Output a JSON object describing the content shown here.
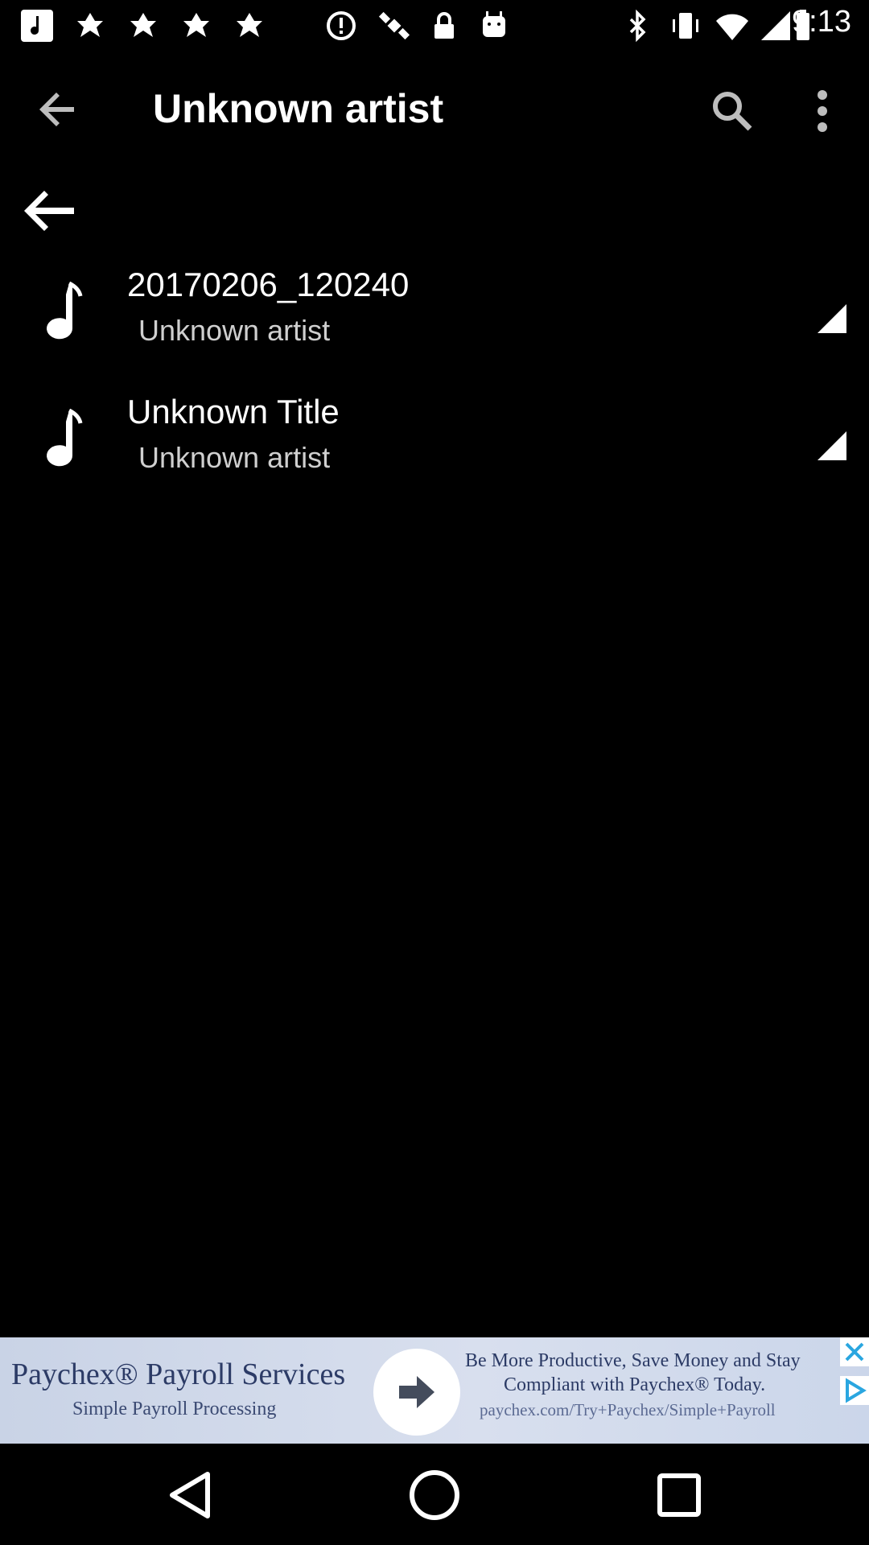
{
  "status_bar": {
    "time": "9:13",
    "icons": [
      "music-note-icon",
      "flower-icon",
      "flower-icon",
      "flower-icon",
      "alert-icon",
      "satellite-icon",
      "lock-icon",
      "android-icon",
      "bluetooth-icon",
      "vibrate-icon",
      "wifi-icon",
      "signal-icon",
      "battery-icon"
    ]
  },
  "app_bar": {
    "title": "Unknown artist",
    "back_icon": "back-arrow-icon",
    "search_icon": "search-icon",
    "more_icon": "more-vert-icon"
  },
  "tracks": [
    {
      "title": "20170206_120240",
      "artist": "Unknown artist"
    },
    {
      "title": "Unknown Title",
      "artist": "Unknown artist"
    }
  ],
  "ad": {
    "title": "Paychex® Payroll Services",
    "subtitle": "Simple Payroll Processing",
    "line1": "Be More Productive, Save Money and Stay",
    "line2": "Compliant with Paychex® Today.",
    "line3": "paychex.com/Try+Paychex/Simple+Payroll"
  },
  "nav_bar": {
    "icons": [
      "back-triangle-icon",
      "home-circle-icon",
      "recents-square-icon"
    ]
  }
}
